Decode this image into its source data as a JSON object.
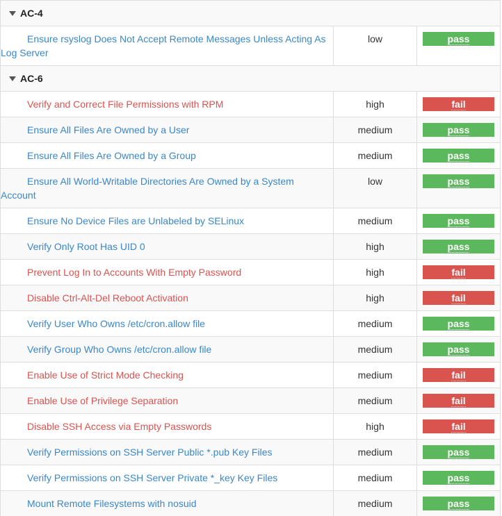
{
  "colors": {
    "pass": "#5cb85c",
    "fail": "#d9534f",
    "link_pass": "#3a87c8",
    "link_fail": "#d9534f"
  },
  "groups": [
    {
      "name": "AC-4",
      "icon": "caret-down-icon",
      "rules": [
        {
          "title": "Ensure rsyslog Does Not Accept Remote Messages Unless Acting As Log Server",
          "severity": "low",
          "result": "pass"
        }
      ]
    },
    {
      "name": "AC-6",
      "icon": "caret-down-icon",
      "rules": [
        {
          "title": "Verify and Correct File Permissions with RPM",
          "severity": "high",
          "result": "fail"
        },
        {
          "title": "Ensure All Files Are Owned by a User",
          "severity": "medium",
          "result": "pass"
        },
        {
          "title": "Ensure All Files Are Owned by a Group",
          "severity": "medium",
          "result": "pass"
        },
        {
          "title": "Ensure All World-Writable Directories Are Owned by a System Account",
          "severity": "low",
          "result": "pass"
        },
        {
          "title": "Ensure No Device Files are Unlabeled by SELinux",
          "severity": "medium",
          "result": "pass"
        },
        {
          "title": "Verify Only Root Has UID 0",
          "severity": "high",
          "result": "pass"
        },
        {
          "title": "Prevent Log In to Accounts With Empty Password",
          "severity": "high",
          "result": "fail"
        },
        {
          "title": "Disable Ctrl-Alt-Del Reboot Activation",
          "severity": "high",
          "result": "fail"
        },
        {
          "title": "Verify User Who Owns /etc/cron.allow file",
          "severity": "medium",
          "result": "pass"
        },
        {
          "title": "Verify Group Who Owns /etc/cron.allow file",
          "severity": "medium",
          "result": "pass"
        },
        {
          "title": "Enable Use of Strict Mode Checking",
          "severity": "medium",
          "result": "fail"
        },
        {
          "title": "Enable Use of Privilege Separation",
          "severity": "medium",
          "result": "fail"
        },
        {
          "title": "Disable SSH Access via Empty Passwords",
          "severity": "high",
          "result": "fail"
        },
        {
          "title": "Verify Permissions on SSH Server Public *.pub Key Files",
          "severity": "medium",
          "result": "pass"
        },
        {
          "title": "Verify Permissions on SSH Server Private *_key Key Files",
          "severity": "medium",
          "result": "pass"
        },
        {
          "title": "Mount Remote Filesystems with nosuid",
          "severity": "medium",
          "result": "pass"
        }
      ]
    }
  ]
}
